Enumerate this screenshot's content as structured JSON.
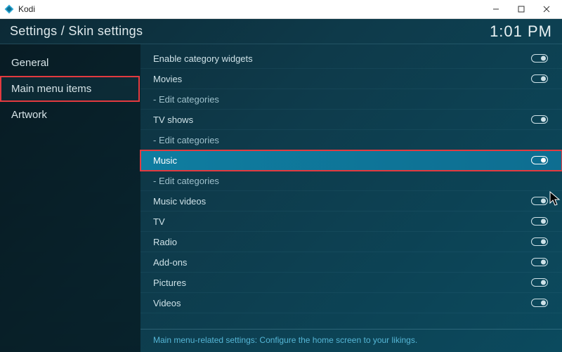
{
  "window": {
    "title": "Kodi"
  },
  "header": {
    "breadcrumb": "Settings / Skin settings",
    "time": "1:01 PM"
  },
  "sidebar": {
    "items": [
      {
        "label": "General",
        "selected": false
      },
      {
        "label": "Main menu items",
        "selected": true
      },
      {
        "label": "Artwork",
        "selected": false
      }
    ]
  },
  "settings": [
    {
      "id": "enable-category-widgets",
      "label": "Enable category widgets",
      "type": "toggle",
      "value": true
    },
    {
      "id": "movies",
      "label": "Movies",
      "type": "toggle",
      "value": true
    },
    {
      "id": "movies-edit",
      "label": "- Edit categories",
      "type": "link"
    },
    {
      "id": "tvshows",
      "label": "TV shows",
      "type": "toggle",
      "value": true
    },
    {
      "id": "tvshows-edit",
      "label": "- Edit categories",
      "type": "link"
    },
    {
      "id": "music",
      "label": "Music",
      "type": "toggle",
      "value": true,
      "highlighted": true
    },
    {
      "id": "music-edit",
      "label": "- Edit categories",
      "type": "link"
    },
    {
      "id": "music-videos",
      "label": "Music videos",
      "type": "toggle",
      "value": true
    },
    {
      "id": "tv",
      "label": "TV",
      "type": "toggle",
      "value": true
    },
    {
      "id": "radio",
      "label": "Radio",
      "type": "toggle",
      "value": true
    },
    {
      "id": "addons",
      "label": "Add-ons",
      "type": "toggle",
      "value": true
    },
    {
      "id": "pictures",
      "label": "Pictures",
      "type": "toggle",
      "value": true
    },
    {
      "id": "videos",
      "label": "Videos",
      "type": "toggle",
      "value": true
    }
  ],
  "footer": {
    "description": "Main menu-related settings: Configure the home screen to your likings."
  },
  "annotation": {
    "highlight_color": "#e33a3f"
  }
}
